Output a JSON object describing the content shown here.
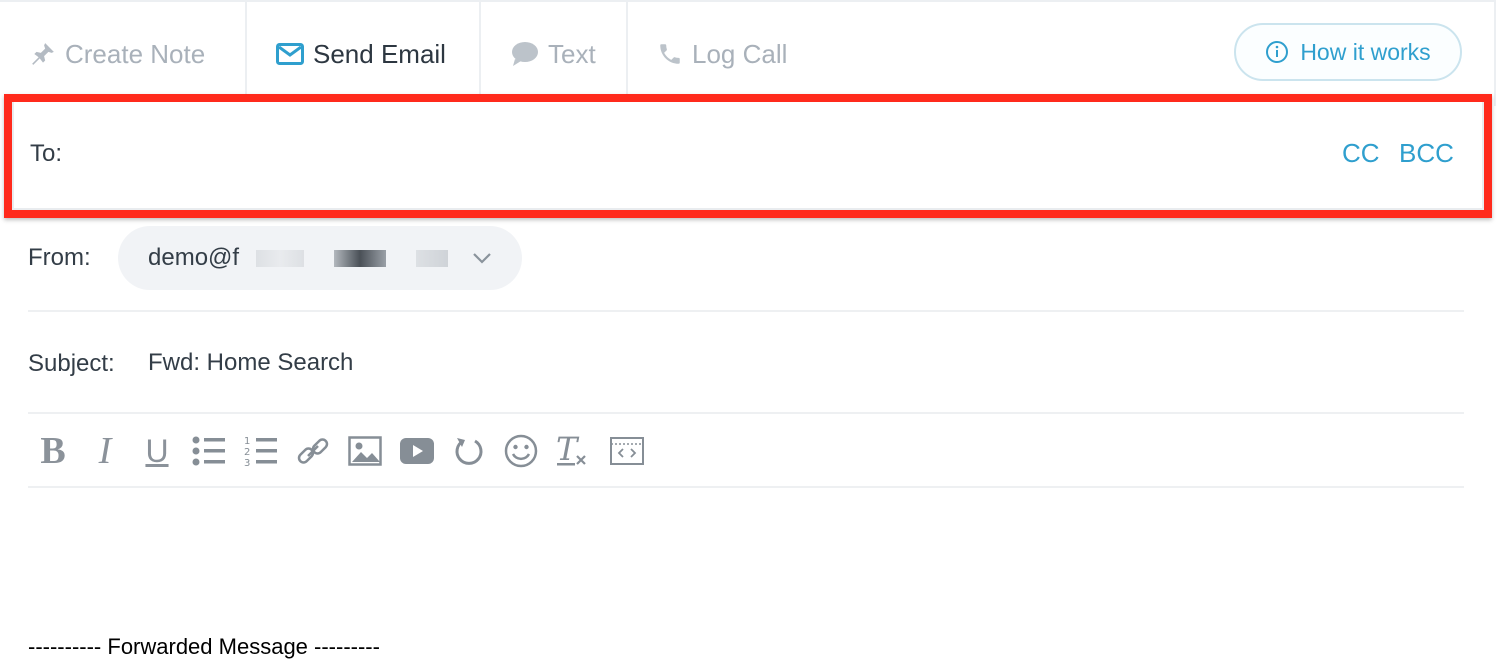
{
  "tabs": [
    {
      "label": "Create Note",
      "icon": "pin-icon",
      "active": false
    },
    {
      "label": "Send Email",
      "icon": "envelope-icon",
      "active": true
    },
    {
      "label": "Text",
      "icon": "chat-bubble-icon",
      "active": false
    },
    {
      "label": "Log Call",
      "icon": "phone-icon",
      "active": false
    }
  ],
  "help": {
    "label": "How it works",
    "icon": "info-icon"
  },
  "to": {
    "label": "To:",
    "value": "",
    "cc_label": "CC",
    "bcc_label": "BCC"
  },
  "from": {
    "label": "From:",
    "value": "demo@f"
  },
  "subject": {
    "label": "Subject:",
    "value": "Fwd: Home Search"
  },
  "toolbar": [
    "bold",
    "italic",
    "underline",
    "bulleted-list",
    "numbered-list",
    "link",
    "image",
    "video",
    "undo",
    "emoji",
    "clear-format",
    "source-code"
  ],
  "message": {
    "forwarded_line": "---------- Forwarded Message ---------"
  },
  "colors": {
    "accent": "#2f9fce",
    "highlight": "#ff2a1c",
    "muted": "#a9b1ba"
  }
}
